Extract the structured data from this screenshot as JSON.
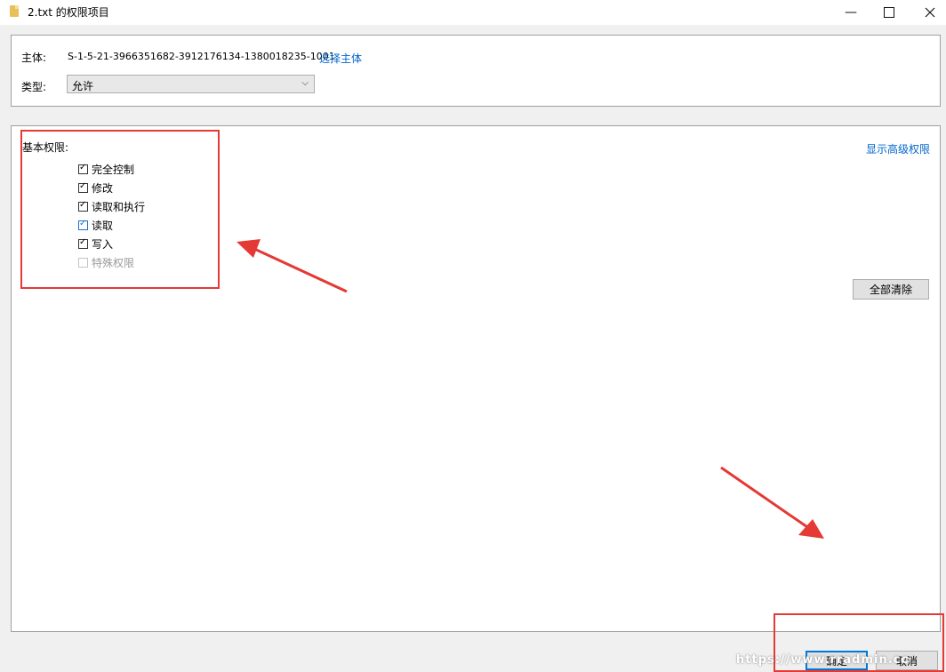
{
  "window": {
    "title": "2.txt 的权限项目",
    "minimize_glyph": "—"
  },
  "principal": {
    "label": "主体:",
    "value": "S-1-5-21-3966351682-3912176134-1380018235-1001",
    "link": "选择主体"
  },
  "type": {
    "label": "类型:",
    "value": "允许",
    "chevron": "⌵"
  },
  "basic_permissions": {
    "heading": "基本权限:",
    "advanced_link": "显示高级权限",
    "items": [
      {
        "label": "完全控制",
        "checked": true
      },
      {
        "label": "修改",
        "checked": true
      },
      {
        "label": "读取和执行",
        "checked": true
      },
      {
        "label": "读取",
        "checked": true
      },
      {
        "label": "写入",
        "checked": true
      },
      {
        "label": "特殊权限",
        "checked": false,
        "disabled": true
      }
    ],
    "clear_all": "全部清除"
  },
  "footer": {
    "ok": "确定",
    "cancel": "取消"
  },
  "watermark": "https://www.rradmin.cc",
  "colors": {
    "annotation_red": "#e53935",
    "link_blue": "#0066cc"
  }
}
